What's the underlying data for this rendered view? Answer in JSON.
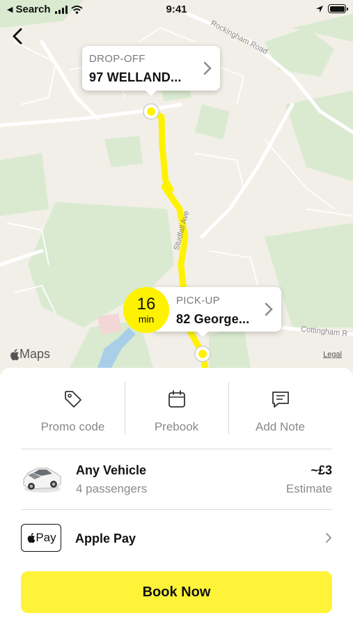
{
  "status_bar": {
    "back_label": "Search",
    "time": "9:41"
  },
  "map": {
    "road_labels": [
      "Rockingham Road",
      "Studfall Ave",
      "Cottingham R"
    ],
    "brand": "Maps",
    "legal": "Legal",
    "route_color": "#fff200"
  },
  "dropoff": {
    "label": "DROP-OFF",
    "address": "97 WELLAND..."
  },
  "pickup": {
    "label": "PICK-UP",
    "address": "82 George..."
  },
  "eta": {
    "value": "16",
    "unit": "min"
  },
  "actions": [
    {
      "label": "Promo code",
      "icon": "tag-icon"
    },
    {
      "label": "Prebook",
      "icon": "calendar-icon"
    },
    {
      "label": "Add Note",
      "icon": "note-icon"
    }
  ],
  "vehicle": {
    "name": "Any Vehicle",
    "passengers": "4 passengers",
    "price": "~£3",
    "price_note": "Estimate"
  },
  "payment": {
    "badge": "Pay",
    "method": "Apple Pay"
  },
  "book_button": {
    "label": "Book Now",
    "color": "#fff33a"
  }
}
